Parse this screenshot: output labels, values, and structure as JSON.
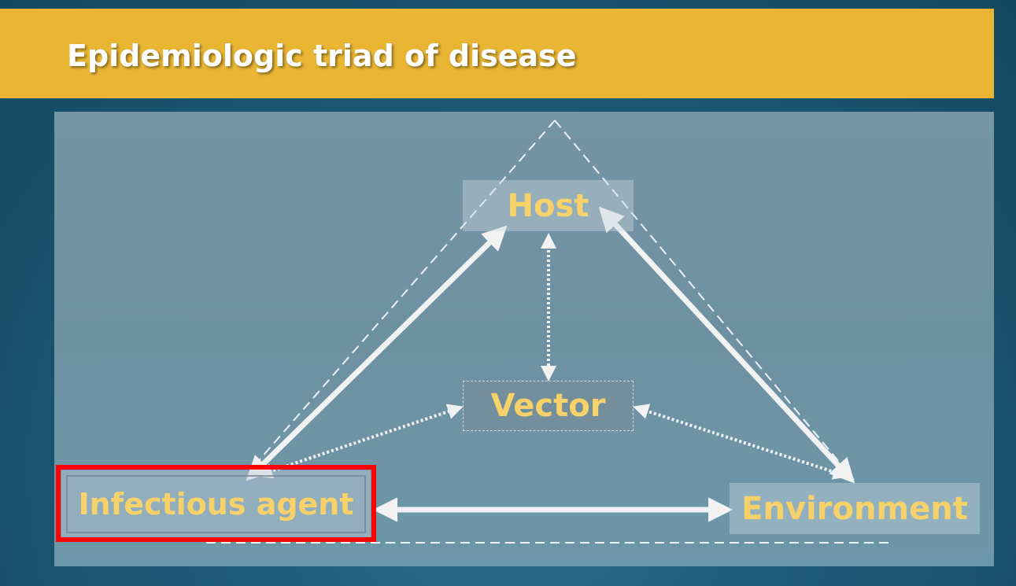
{
  "title": "Epidemiologic triad of disease",
  "nodes": {
    "host": "Host",
    "vector": "Vector",
    "agent": "Infectious agent",
    "environment": "Environment"
  },
  "colors": {
    "title_bar": "#e9b634",
    "node_text": "#f7d26a",
    "highlight": "#ff0000",
    "arrows": "#f2f2f2"
  }
}
